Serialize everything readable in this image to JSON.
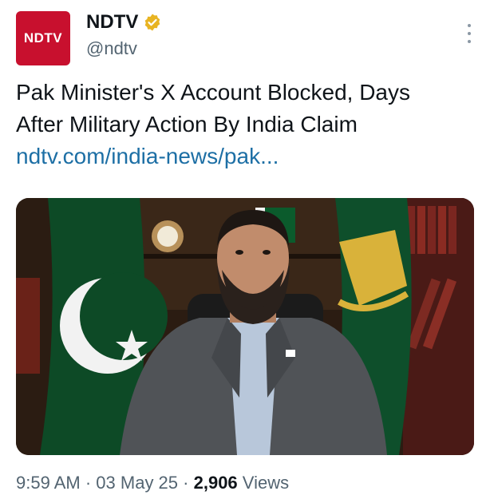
{
  "author": {
    "avatar_text": "NDTV",
    "display_name": "NDTV",
    "handle": "@ndtv",
    "verified_color": "#e8b422"
  },
  "post": {
    "text_line1": "Pak Minister's X Account Blocked, Days",
    "text_line2": "After Military Action By India Claim",
    "link": "ndtv.com/india-news/pak...",
    "media_description_icon": "video-frame-image"
  },
  "meta": {
    "time": "9:59 AM",
    "separator": "·",
    "date": "03 May 25",
    "views_count": "2,906",
    "views_label": "Views"
  },
  "colors": {
    "link": "#1d6fa5",
    "secondary_text": "#536471",
    "brand_red": "#c8102e"
  }
}
